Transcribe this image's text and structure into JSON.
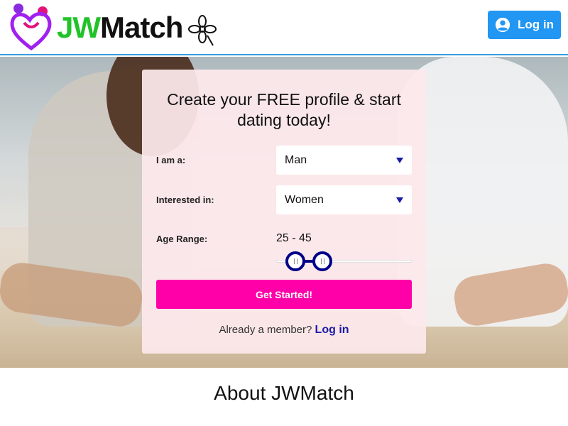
{
  "header": {
    "logo_prefix": "JW",
    "logo_suffix": "Match",
    "login_label": "Log in"
  },
  "form": {
    "title": "Create your FREE profile & start dating today!",
    "i_am_label": "I am a:",
    "i_am_value": "Man",
    "interested_label": "Interested in:",
    "interested_value": "Women",
    "age_label": "Age Range:",
    "age_value": "25 - 45",
    "age_min": 25,
    "age_max": 45,
    "cta_label": "Get Started!",
    "member_text": "Already a member?",
    "member_link": "Log in"
  },
  "about": {
    "title": "About JWMatch"
  },
  "colors": {
    "brand_green": "#22c32a",
    "login_blue": "#2196f3",
    "cta_pink": "#ff00a8",
    "slider_navy": "#00008b",
    "logo_heart": "#a020f0",
    "logo_dot_pink": "#e0147a"
  },
  "icons": {
    "login": "user-circle-icon",
    "logo_mark": "heart-couple-icon",
    "logo_flower": "flower-icon",
    "select_caret": "caret-down-icon"
  }
}
